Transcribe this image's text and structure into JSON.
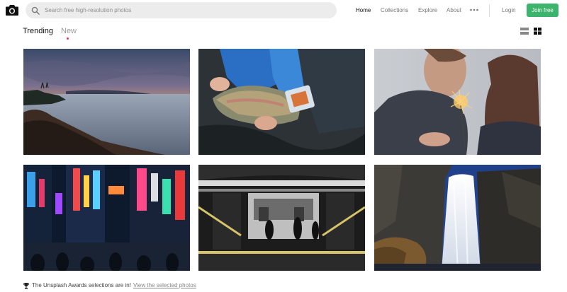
{
  "header": {
    "search": {
      "placeholder": "Search free high-resolution photos",
      "value": ""
    },
    "nav": [
      {
        "label": "Home",
        "active": true
      },
      {
        "label": "Collections",
        "active": false
      },
      {
        "label": "Explore",
        "active": false
      },
      {
        "label": "About",
        "active": false
      }
    ],
    "login_label": "Login",
    "join_label": "Join free",
    "accent_color": "#3cb46e"
  },
  "tabs": [
    {
      "label": "Trending",
      "active": true
    },
    {
      "label": "New",
      "active": false,
      "indicator_color": "#e8345a"
    }
  ],
  "view_toggle": {
    "options": [
      "list-view-icon",
      "grid-view-icon"
    ],
    "selected": "grid"
  },
  "photos": [
    {
      "subject": "coastal sunset"
    },
    {
      "subject": "hands holding a trout"
    },
    {
      "subject": "couple with sparkler"
    },
    {
      "subject": "neon city street at night"
    },
    {
      "subject": "subway station platform"
    },
    {
      "subject": "waterfall at dusk"
    }
  ],
  "footer": {
    "message": "The Unsplash Awards selections are in!",
    "link_label": "View the selected photos",
    "icon": "trophy-icon"
  }
}
